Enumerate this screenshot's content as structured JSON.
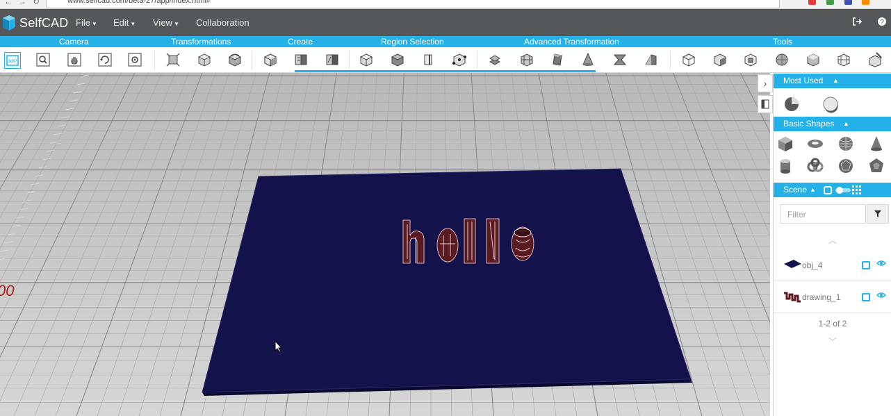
{
  "browser": {
    "url": "www.selfcad.com/beta-27/app/index.html#"
  },
  "app": {
    "logo_text": "SelfCAD"
  },
  "menu": {
    "file": "File",
    "edit": "Edit",
    "view": "View",
    "collaboration": "Collaboration"
  },
  "categories": {
    "camera": "Camera",
    "transformations": "Transformations",
    "create": "Create",
    "region_selection": "Region Selection",
    "advanced_transformation": "Advanced Transformation",
    "tools": "Tools"
  },
  "toolbar": {
    "view_2d3d": "3d/P"
  },
  "viewport": {
    "ruler_label": "00",
    "text_object": "hello",
    "plate_color": "#13124a",
    "text_color": "#5a1a22"
  },
  "panel": {
    "most_used": "Most Used",
    "basic_shapes": "Basic Shapes",
    "scene": "Scene",
    "filter_placeholder": "Filter",
    "objects": [
      {
        "name": "obj_4"
      },
      {
        "name": "drawing_1"
      }
    ],
    "pager": "1-2 of 2"
  },
  "colors": {
    "accent": "#23b1e8",
    "appbar": "#555758",
    "grid_bg": "#c7c7c7"
  }
}
